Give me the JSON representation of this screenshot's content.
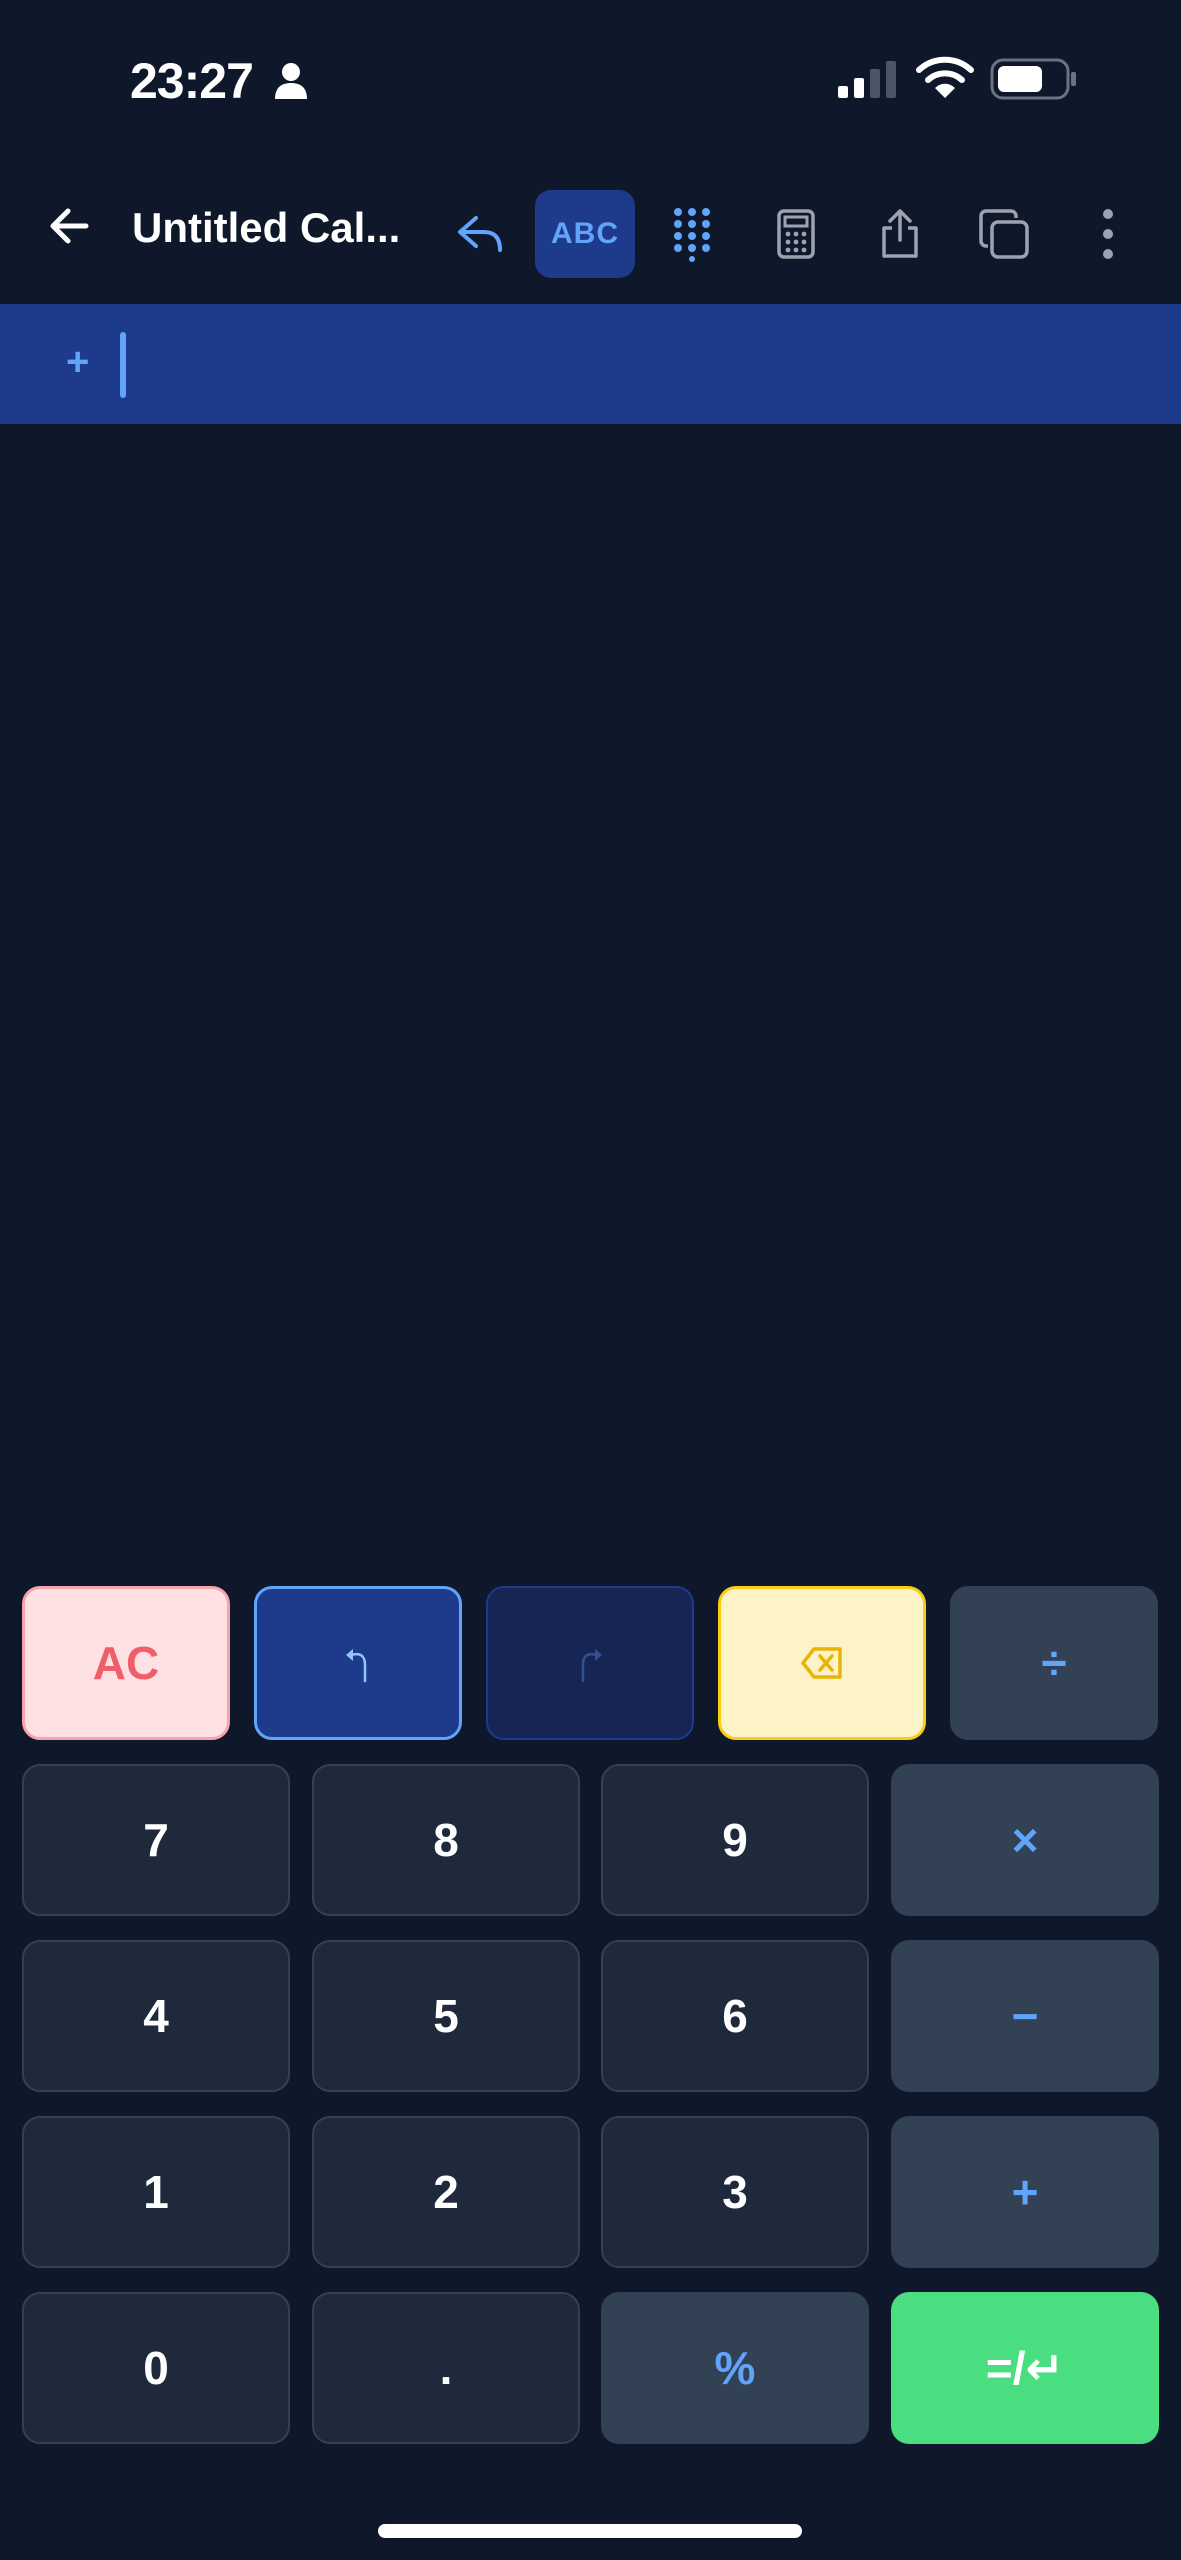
{
  "status_bar": {
    "time": "23:27"
  },
  "header": {
    "title": "Untitled Cal...",
    "abc_label": "ABC"
  },
  "input": {
    "prefix": "+"
  },
  "keys": {
    "ac": "AC",
    "divide": "÷",
    "seven": "7",
    "eight": "8",
    "nine": "9",
    "multiply": "×",
    "four": "4",
    "five": "5",
    "six": "6",
    "minus": "−",
    "one": "1",
    "two": "2",
    "three": "3",
    "plus": "+",
    "zero": "0",
    "dot": ".",
    "percent": "%",
    "equals": "=/↵"
  },
  "colors": {
    "background": "#0f172a",
    "accent": "#60a5fa",
    "input_bar": "#1e3a8a",
    "clear": "#ef5f6a",
    "backspace": "#eab308",
    "equals": "#4ade80"
  }
}
